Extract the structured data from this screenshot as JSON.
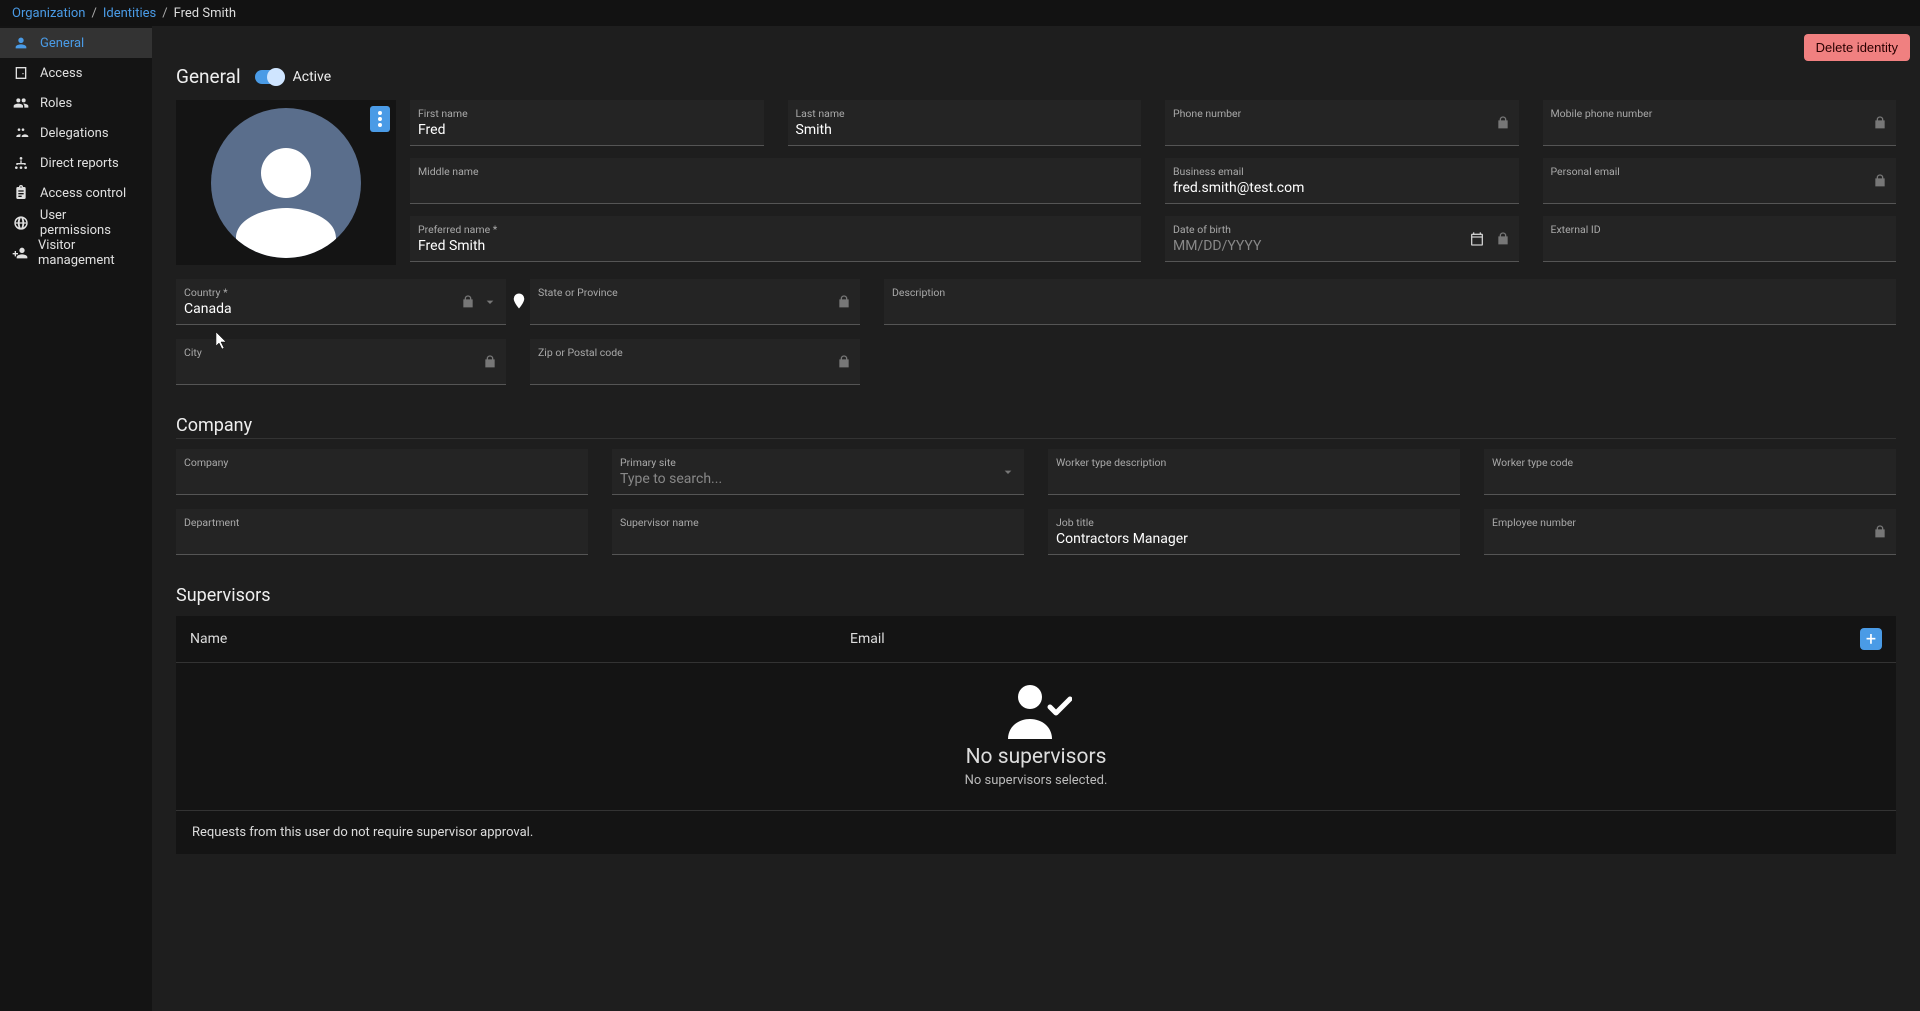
{
  "breadcrumb": {
    "org": "Organization",
    "identities": "Identities",
    "current": "Fred Smith"
  },
  "sidebar": {
    "items": [
      {
        "label": "General"
      },
      {
        "label": "Access"
      },
      {
        "label": "Roles"
      },
      {
        "label": "Delegations"
      },
      {
        "label": "Direct reports"
      },
      {
        "label": "Access control"
      },
      {
        "label": "User permissions"
      },
      {
        "label": "Visitor management"
      }
    ]
  },
  "actions": {
    "delete": "Delete identity"
  },
  "general": {
    "title": "General",
    "active_label": "Active",
    "first_name": {
      "label": "First name",
      "value": "Fred"
    },
    "last_name": {
      "label": "Last name",
      "value": "Smith"
    },
    "phone": {
      "label": "Phone number",
      "value": ""
    },
    "mobile": {
      "label": "Mobile phone number",
      "value": ""
    },
    "middle_name": {
      "label": "Middle name",
      "value": ""
    },
    "business_email": {
      "label": "Business email",
      "value": "fred.smith@test.com"
    },
    "personal_email": {
      "label": "Personal email",
      "value": ""
    },
    "preferred_name": {
      "label": "Preferred name *",
      "value": "Fred Smith"
    },
    "dob": {
      "label": "Date of birth",
      "placeholder": "MM/DD/YYYY"
    },
    "external_id": {
      "label": "External ID",
      "value": ""
    },
    "country": {
      "label": "Country *",
      "value": "Canada"
    },
    "state": {
      "label": "State or Province",
      "value": ""
    },
    "description": {
      "label": "Description",
      "value": ""
    },
    "city": {
      "label": "City",
      "value": ""
    },
    "zip": {
      "label": "Zip or Postal code",
      "value": ""
    }
  },
  "company": {
    "title": "Company",
    "company": {
      "label": "Company",
      "value": ""
    },
    "primary_site": {
      "label": "Primary site",
      "placeholder": "Type to search..."
    },
    "worker_desc": {
      "label": "Worker type description",
      "value": ""
    },
    "worker_code": {
      "label": "Worker type code",
      "value": ""
    },
    "department": {
      "label": "Department",
      "value": ""
    },
    "supervisor_name": {
      "label": "Supervisor name",
      "value": ""
    },
    "job_title": {
      "label": "Job title",
      "value": "Contractors Manager"
    },
    "employee_number": {
      "label": "Employee number",
      "value": ""
    }
  },
  "supervisors": {
    "title": "Supervisors",
    "col_name": "Name",
    "col_email": "Email",
    "empty_title": "No supervisors",
    "empty_sub": "No supervisors selected.",
    "note": "Requests from this user do not require supervisor approval."
  }
}
